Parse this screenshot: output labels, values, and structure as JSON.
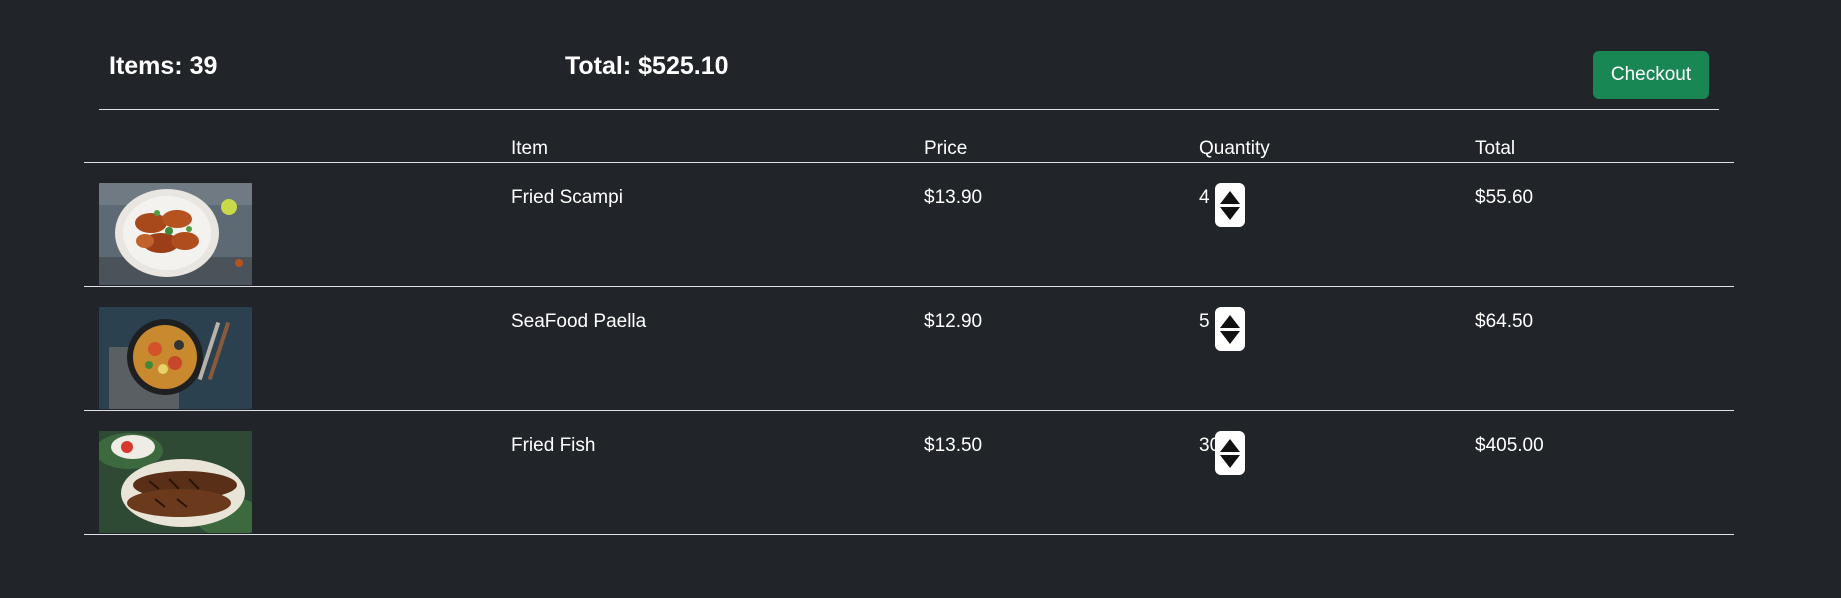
{
  "summary": {
    "items_label": "Items: 39",
    "total_label": "Total: $525.10",
    "checkout_label": "Checkout"
  },
  "table": {
    "headers": [
      "",
      "Item",
      "Price",
      "Quantity",
      "Total"
    ],
    "rows": [
      {
        "image": "fried-scampi-photo",
        "item": "Fried Scampi",
        "price": "$13.90",
        "quantity": "4",
        "total": "$55.60"
      },
      {
        "image": "seafood-paella-photo",
        "item": "SeaFood Paella",
        "price": "$12.90",
        "quantity": "5",
        "total": "$64.50"
      },
      {
        "image": "fried-fish-photo",
        "item": "Fried Fish",
        "price": "$13.50",
        "quantity": "30",
        "total": "$405.00"
      }
    ]
  },
  "colors": {
    "background": "#212529",
    "checkout": "#198754",
    "divider": "#dee2e6"
  }
}
